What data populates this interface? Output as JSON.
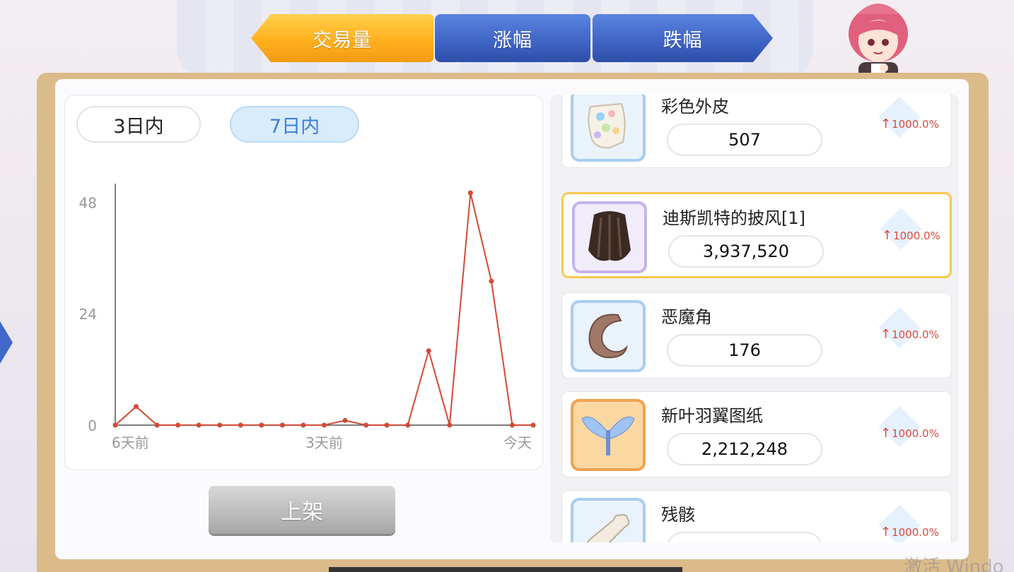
{
  "tabs": [
    {
      "label": "交易量",
      "active": true
    },
    {
      "label": "涨幅",
      "active": false
    },
    {
      "label": "跌幅",
      "active": false
    }
  ],
  "range_buttons": {
    "three_day": "3日内",
    "seven_day": "7日内",
    "selected": "7日内"
  },
  "list_button": "上架",
  "chart_data": {
    "type": "line",
    "series": [
      {
        "values": [
          0,
          4,
          0,
          0,
          0,
          0,
          0,
          0,
          0,
          0,
          0,
          1,
          0,
          0,
          0,
          16,
          0,
          50,
          31,
          0,
          0
        ]
      }
    ],
    "yticks": [
      "48",
      "24",
      "0"
    ],
    "ylim": [
      0,
      52
    ],
    "xticks": [
      "6天前",
      "3天前",
      "今天"
    ],
    "color": "#d24a36",
    "grid": false
  },
  "items": [
    {
      "name": "彩色外皮",
      "price": "507",
      "change": "1000.0%",
      "icon": "colorful-skin-icon"
    },
    {
      "name": "迪斯凯特的披风[1]",
      "price": "3,937,520",
      "change": "1000.0%",
      "icon": "cape-icon",
      "selected": true
    },
    {
      "name": "恶魔角",
      "price": "176",
      "change": "1000.0%",
      "icon": "demon-horn-icon"
    },
    {
      "name": "新叶羽翼图纸",
      "price": "2,212,248",
      "change": "1000.0%",
      "icon": "wing-blueprint-icon"
    },
    {
      "name": "残骸",
      "price": "",
      "change": "1000.0%",
      "icon": "bone-icon"
    }
  ],
  "watermark": "激活 Windo",
  "colors": {
    "active_tab": "#ffb01e",
    "inactive_tab": "#3e63c4",
    "rise": "#e04a3a",
    "selected_border": "#f8c84a"
  }
}
